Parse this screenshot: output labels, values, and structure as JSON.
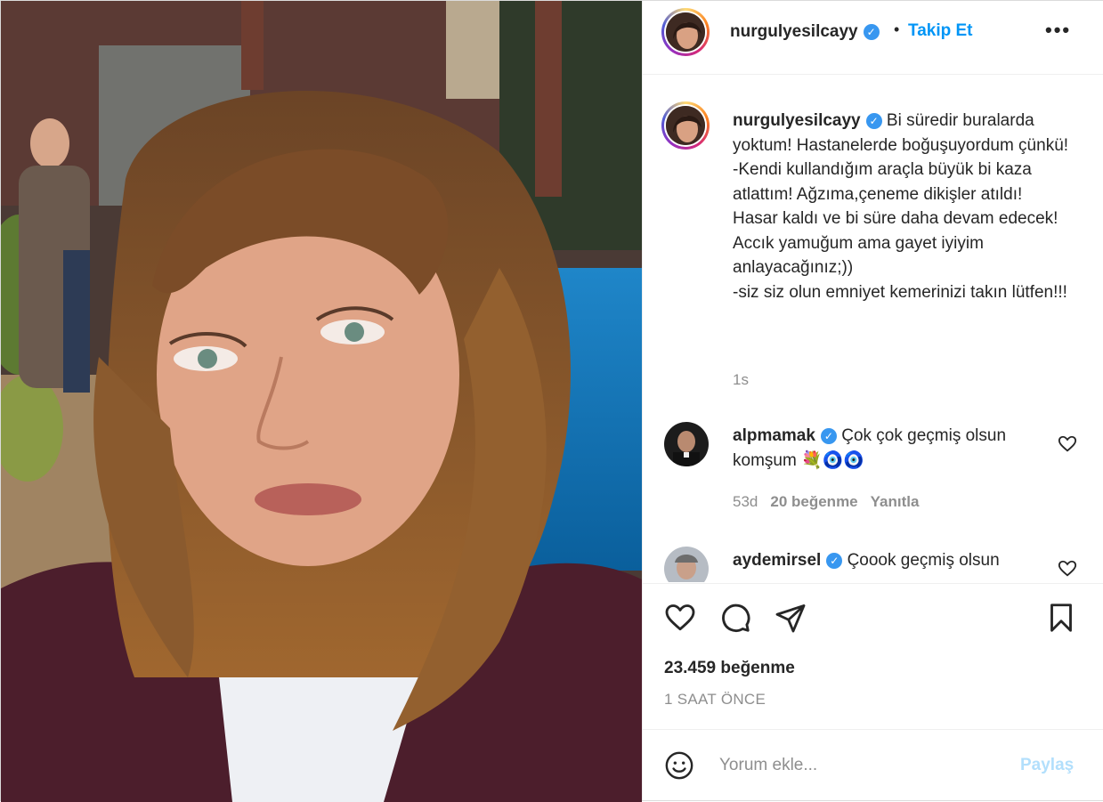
{
  "post": {
    "author": "nurgulyesilcayy",
    "follow_label": "Takip Et",
    "separator": "•",
    "more_label": "•••"
  },
  "caption": {
    "username": "nurgulyesilcayy",
    "text": "Bi süredir buralarda yoktum! Hastanelerde boğuşuyordum çünkü!\n-Kendi kullandığım araçla büyük bi kaza atlattım! Ağzıma,çeneme dikişler atıldı! Hasar kaldı ve bi süre daha devam edecek! Accık yamuğum ama gayet iyiyim anlayacağınız;))\n-siz siz olun emniyet kemerinizi takın lütfen!!!",
    "time": "1s"
  },
  "comments": [
    {
      "username": "alpmamak",
      "text": "Çok çok geçmiş olsun komşum 💐🧿🧿",
      "time": "53d",
      "likes": "20 beğenme",
      "reply": "Yanıtla"
    },
    {
      "username": "aydemirsel",
      "text": "Çoook geçmiş olsun"
    }
  ],
  "stats": {
    "likes": "23.459 beğenme",
    "time": "1 SAAT ÖNCE"
  },
  "composer": {
    "placeholder": "Yorum ekle...",
    "share_label": "Paylaş"
  },
  "icons": {
    "verified": "verified-badge-icon",
    "like": "heart-icon",
    "comment": "comment-bubble-icon",
    "share": "paper-plane-icon",
    "save": "bookmark-icon",
    "emoji": "smiley-icon",
    "more": "more-dots-icon"
  },
  "colors": {
    "accent_blue": "#0095f6",
    "verified_blue": "#3897f0",
    "muted_text": "#8e8e8e",
    "share_disabled": "#b2dffc"
  }
}
